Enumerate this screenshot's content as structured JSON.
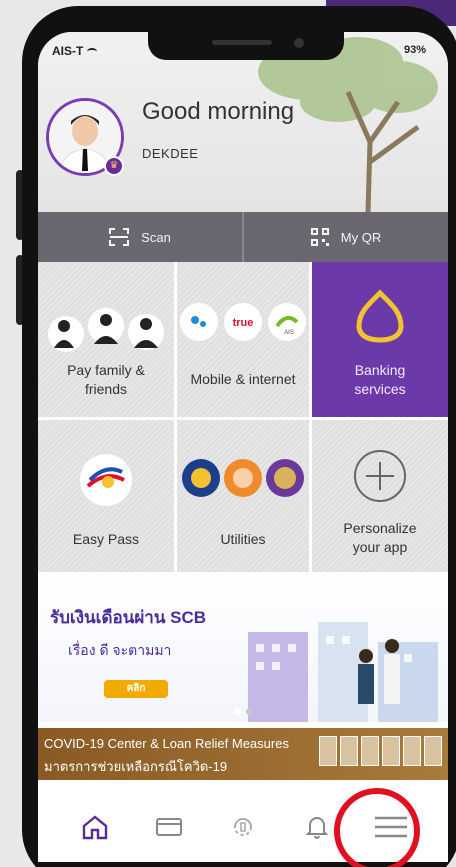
{
  "status_bar": {
    "carrier": "AIS-T",
    "battery": "93%"
  },
  "header": {
    "greeting": "Good morning",
    "username": "DEKDEE"
  },
  "actions": [
    {
      "label": "Scan",
      "icon": "scan-icon"
    },
    {
      "label": "My QR",
      "icon": "qr-code-icon"
    }
  ],
  "tiles": [
    {
      "label": "Pay family & friends",
      "icon": "people-icon"
    },
    {
      "label": "Mobile & internet",
      "icon": "telecom-logos-icon"
    },
    {
      "label": "Banking services",
      "icon": "scb-logo-icon"
    },
    {
      "label": "Easy Pass",
      "icon": "easy-pass-icon"
    },
    {
      "label": "Utilities",
      "icon": "utilities-logos-icon"
    },
    {
      "label": "Personalize your app",
      "icon": "plus-circle-icon"
    }
  ],
  "telecom_logos": [
    "true",
    "AIS"
  ],
  "banner": {
    "title": "รับเงินเดือนผ่าน SCB",
    "subtitle": "เรื่อง ดี จะตามมา",
    "cta": "คลิก"
  },
  "covid": {
    "line1": "COVID-19 Center & Loan Relief Measures",
    "line2": "มาตรการช่วยเหลือกรณีโควิด-19"
  },
  "nav": [
    {
      "icon": "home-icon"
    },
    {
      "icon": "wallet-icon"
    },
    {
      "icon": "rewards-icon"
    },
    {
      "icon": "bell-icon"
    },
    {
      "icon": "menu-icon"
    }
  ],
  "colors": {
    "brand_purple": "#6b3aa8",
    "action_bar": "#6b6770",
    "highlight_red": "#e01020",
    "banner_button": "#f2a900"
  }
}
